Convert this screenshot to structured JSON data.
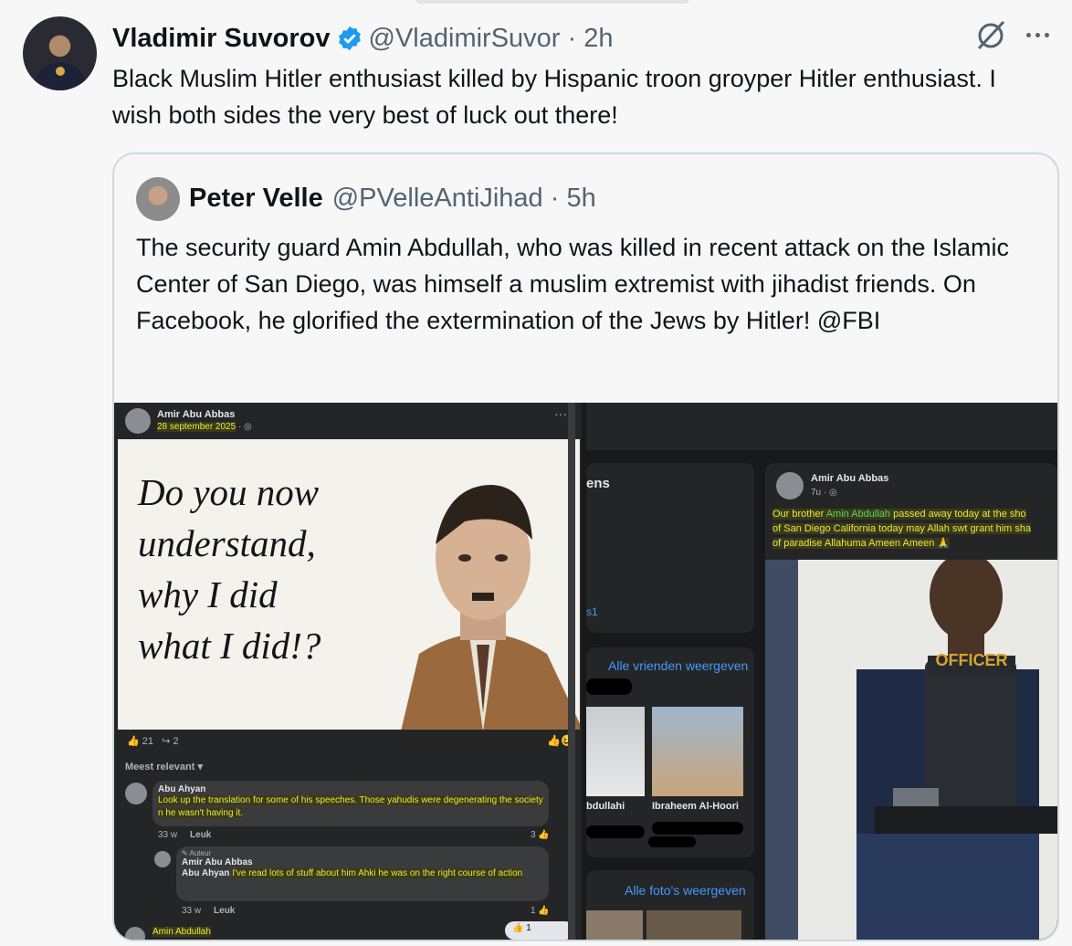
{
  "post": {
    "author_name": "Vladimir Suvorov",
    "handle": "@VladimirSuvor",
    "time": "2h",
    "text": "Black Muslim Hitler enthusiast killed by Hispanic troon groyper Hitler enthusiast. I wish both sides the very best of luck out there!"
  },
  "quote": {
    "author_name": "Peter Velle",
    "handle": "@PVelleAntiJihad",
    "time": "5h",
    "text": "The security guard Amin Abdullah, who was killed in recent attack on the Islamic Center of San Diego, was himself a muslim extremist with jihadist friends. On Facebook, he glorified the extermination of the Jews by Hitler! @FBI"
  },
  "left_panel": {
    "poster": "Amir Abu Abbas",
    "date": "28 september 2025",
    "meme_text": [
      "Do you now",
      "understand,",
      "why I did",
      "what I did!?"
    ],
    "likes": "21",
    "shares": "2",
    "sort": "Meest relevant",
    "comment1_author": "Abu Ahyan",
    "comment1_text": "Look up the translation for some of his speeches. Those yahudis were degenerating the society n he wasn't having it.",
    "comment1_time": "33 w",
    "comment1_like": "Leuk",
    "comment1_count": "3",
    "reply_badge": "Auteur",
    "reply_author": "Amir Abu Abbas",
    "reply_mention": "Abu Ahyan",
    "reply_text": "I've read lots of stuff about him Ahki he was on the right course of action",
    "reply_time": "33 w",
    "reply_like": "Leuk",
    "reply_count": "1",
    "comment3_author": "Amin Abdullah",
    "comment3_count": "1"
  },
  "right_panel": {
    "friends_fragment": "ens",
    "s1_fragment": "s1",
    "all_friends_link": "Alle vrienden weergeven",
    "friend1_name": "bdullahi",
    "friend2_name": "Ibraheem Al-Hoori",
    "all_photos_link": "Alle foto's weergeven",
    "post_author": "Amir Abu Abbas",
    "post_time": "7u",
    "post_text_pre": "Our brother ",
    "post_text_name": "Amin Abdullah",
    "post_text_rest": " passed away today at the sho",
    "post_line2": "of San Diego California today may Allah swt grant him sha",
    "post_line3": "of paradise Allahuma Ameen Ameen 🙏",
    "vest_label": "OFFICER"
  },
  "colors": {
    "verified": "#1d9bf0",
    "fb_dark": "#242526",
    "highlight": "#e8e840",
    "link": "#4599ff"
  }
}
